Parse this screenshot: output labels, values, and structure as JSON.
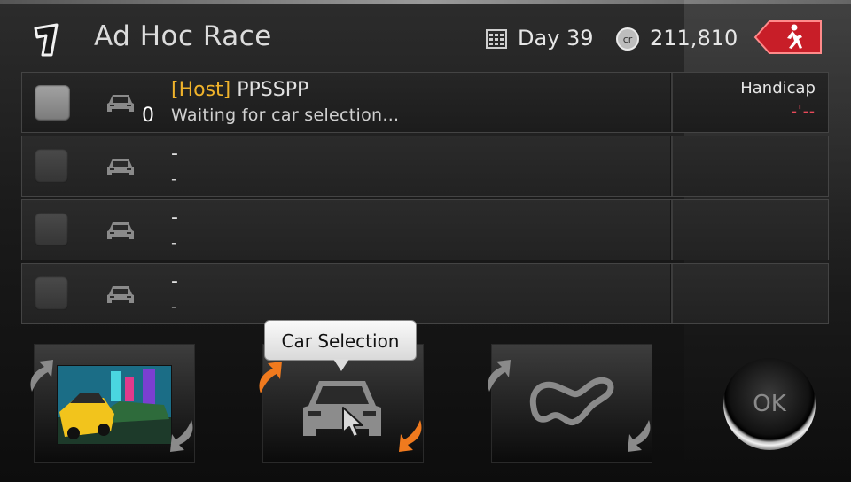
{
  "header": {
    "title": "Ad Hoc Race",
    "day": "Day 39",
    "credits": "211,810",
    "credits_symbol": "cr",
    "exit_icon": "running-man-exit-icon",
    "exit_color": "#c81e28"
  },
  "slots": [
    {
      "host_tag": "[Host]",
      "name": "PPSSPP",
      "count": "0",
      "status": "Waiting for car selection...",
      "handicap_label": "Handicap",
      "handicap_value": "-'--"
    },
    {
      "name": "-",
      "status": "-"
    },
    {
      "name": "-",
      "status": "-"
    },
    {
      "name": "-",
      "status": "-"
    }
  ],
  "bottom": {
    "tooltip": "Car Selection",
    "ok_label": "OK"
  },
  "colors": {
    "host_tag": "#f0b32b",
    "handicap_value": "#e84a5a",
    "arrow_active": "#f07a1e"
  }
}
